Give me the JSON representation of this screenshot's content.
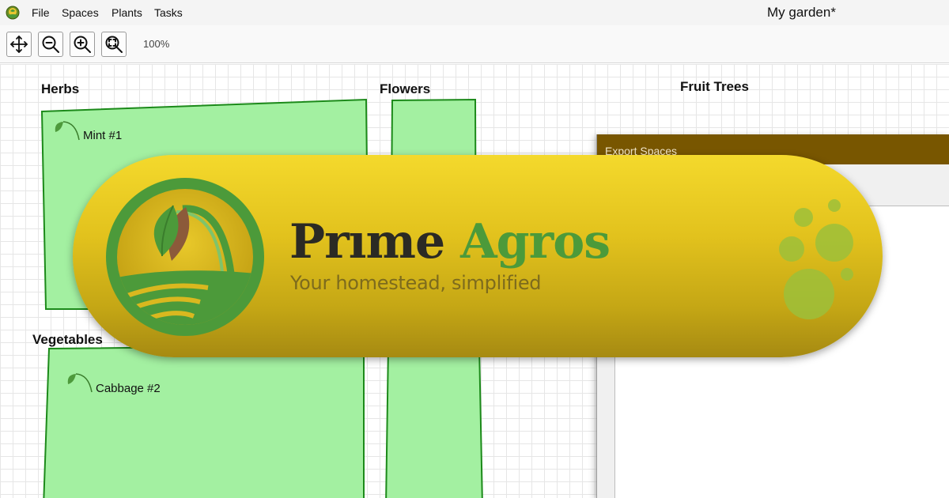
{
  "menubar": {
    "app_icon": "app-logo-icon",
    "items": [
      {
        "label": "File"
      },
      {
        "label": "Spaces"
      },
      {
        "label": "Plants"
      },
      {
        "label": "Tasks"
      }
    ],
    "window_title": "My garden*"
  },
  "toolbar": {
    "tools": [
      {
        "icon": "move-icon"
      },
      {
        "icon": "zoom-out-icon"
      },
      {
        "icon": "zoom-in-icon"
      },
      {
        "icon": "zoom-fit-icon"
      }
    ],
    "zoom_level": "100%"
  },
  "garden": {
    "spaces": [
      {
        "label": "Herbs",
        "plants": [
          {
            "label": "Mint #1",
            "icon": "sprout-icon"
          }
        ]
      },
      {
        "label": "Flowers",
        "plants": []
      },
      {
        "label": "Fruit Trees",
        "plants": []
      },
      {
        "label": "Vegetables",
        "plants": [
          {
            "label": "Cabbage #2",
            "icon": "sprout-icon"
          }
        ]
      }
    ],
    "colors": {
      "space_fill": "#a3f0a1",
      "space_border": "#1c8a1a"
    }
  },
  "dialog": {
    "title": "Export Spaces",
    "colors": {
      "titlebar": "#785600"
    }
  },
  "banner": {
    "brand_word_1": "Prıme",
    "brand_word_2": "Agros",
    "tagline": "Your homestead, simplified",
    "logo_icon": "prime-agros-logo-icon",
    "colors": {
      "background_top": "#f4d92c",
      "background_bottom": "#a68a12",
      "brand_dark": "#2b2a24",
      "brand_green": "#4c9a3a"
    }
  }
}
